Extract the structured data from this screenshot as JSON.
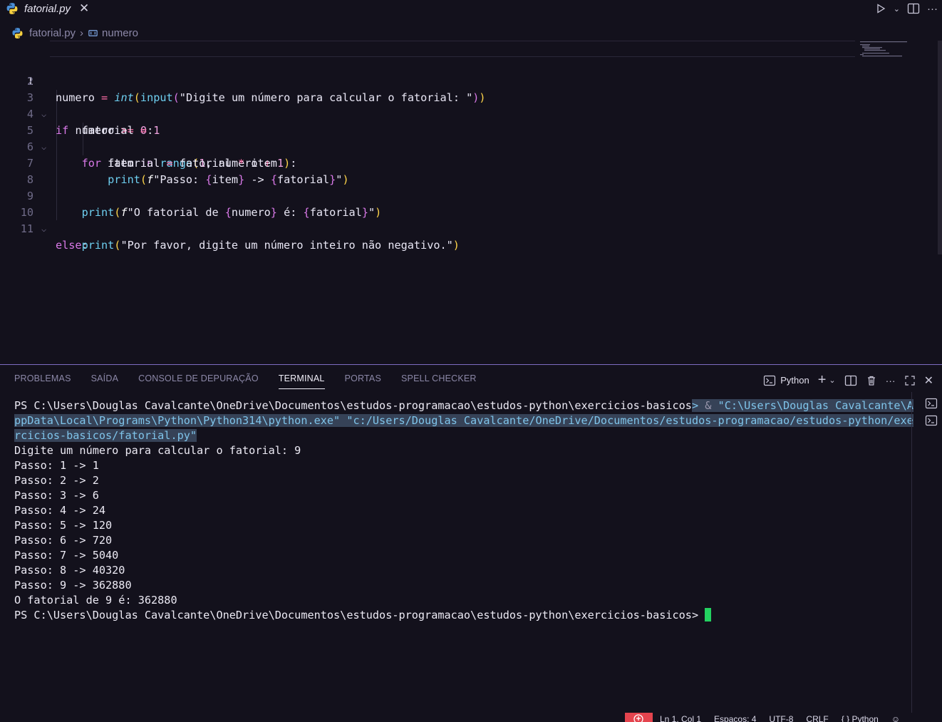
{
  "tab": {
    "label": "fatorial.py"
  },
  "breadcrumb": {
    "file": "fatorial.py",
    "symbol": "numero"
  },
  "editor": {
    "line_numbers": [
      "1",
      "2",
      "3",
      "4",
      "5",
      "6",
      "7",
      "8",
      "9",
      "10",
      "11"
    ],
    "code": [
      "numero = int(input(\"Digite um número para calcular o fatorial: \"))",
      "",
      "if numero >= 0:",
      "    fatorial = 1",
      "    for item in range(1, numero + 1):",
      "        fatorial = fatorial * item",
      "        print(f\"Passo: {item} -> {fatorial}\")",
      "",
      "    print(f\"O fatorial de {numero} é: {fatorial}\")",
      "else:",
      "    print(\"Por favor, digite um número inteiro não negativo.\")"
    ]
  },
  "panel": {
    "tabs": [
      "PROBLEMAS",
      "SAÍDA",
      "CONSOLE DE DEPURAÇÃO",
      "TERMINAL",
      "PORTAS",
      "SPELL CHECKER"
    ],
    "active_tab": "TERMINAL",
    "shell_label": "Python"
  },
  "terminal": {
    "prompt1": "PS C:\\Users\\Douglas Cavalcante\\OneDrive\\Documentos\\estudos-programacao\\estudos-python\\exercicios-basicos",
    "prompt1_end": "> ",
    "amp": "& ",
    "cmd_line1": "\"C:\\Users\\Douglas Cavalcante\\A",
    "cmd_line2": "ppData\\Local\\Programs\\Python\\Python314\\python.exe\" \"c:/Users/Douglas Cavalcante/OneDrive/Documentos/estudos-programacao/estudos-python/exe",
    "cmd_line3": "rcicios-basicos/fatorial.py\"",
    "output": [
      "Digite um número para calcular o fatorial: 9",
      "Passo: 1 -> 1",
      "Passo: 2 -> 2",
      "Passo: 3 -> 6",
      "Passo: 4 -> 24",
      "Passo: 5 -> 120",
      "Passo: 6 -> 720",
      "Passo: 7 -> 5040",
      "Passo: 8 -> 40320",
      "Passo: 9 -> 362880",
      "O fatorial de 9 é: 362880"
    ],
    "prompt2": "PS C:\\Users\\Douglas Cavalcante\\OneDrive\\Documentos\\estudos-programacao\\estudos-python\\exercicios-basicos> "
  },
  "statusbar": {
    "position": "Ln 1, Col 1",
    "spaces": "Espaços: 4",
    "encoding": "UTF-8",
    "eol": "CRLF",
    "language": "{ } Python"
  },
  "colors": {
    "background": "#13111c",
    "accent": "#7d6cc0",
    "cursor": "#23d160",
    "remote": "#e4444e"
  }
}
